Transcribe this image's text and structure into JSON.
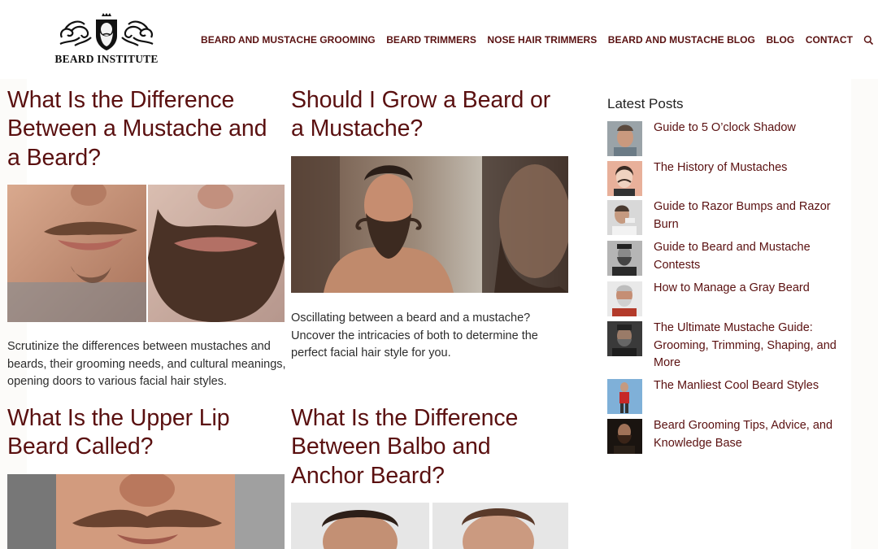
{
  "header": {
    "logo_text": "BEARD INSTITUTE",
    "nav": [
      "BEARD AND MUSTACHE GROOMING",
      "BEARD TRIMMERS",
      "NOSE HAIR TRIMMERS",
      "BEARD AND MUSTACHE BLOG",
      "BLOG",
      "CONTACT"
    ]
  },
  "posts": [
    {
      "title": "What Is the Difference Between a Mustache and a Beard?",
      "excerpt": "Scrutinize the differences between mustaches and beards, their grooming needs, and cultural meanings, opening doors to various facial hair styles."
    },
    {
      "title": "Should I Grow a Beard or a Mustache?",
      "excerpt": "Oscillating between a beard and a mustache? Uncover the intricacies of both to determine the perfect facial hair style for you."
    },
    {
      "title": "What Is the Upper Lip Beard Called?",
      "excerpt": ""
    },
    {
      "title": "What Is the Difference Between Balbo and Anchor Beard?",
      "excerpt": ""
    }
  ],
  "sidebar": {
    "heading": "Latest Posts",
    "items": [
      "Guide to 5 O’clock Shadow",
      "The History of Mustaches",
      "Guide to Razor Bumps and Razor Burn",
      "Guide to Beard and Mustache Contests",
      "How to Manage a Gray Beard",
      "The Ultimate Mustache Guide: Grooming, Trimming, Shaping, and More",
      "The Manliest Cool Beard Styles",
      "Beard Grooming Tips, Advice, and Knowledge Base"
    ]
  },
  "colors": {
    "link": "#5a1010",
    "nav": "#5a1212",
    "page_bg": "#fcfbf9"
  },
  "icons": {
    "search": "search-icon",
    "logo": "beard-crest-logo"
  }
}
